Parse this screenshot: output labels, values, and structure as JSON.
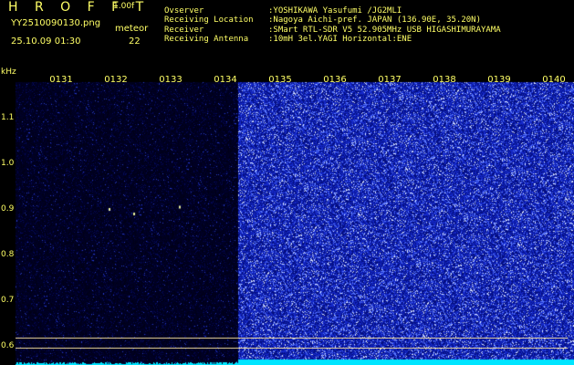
{
  "header": {
    "brand": "H R O F F T",
    "version": "1.00f",
    "filename": "YY2510090130.png",
    "meteor_label": "meteor",
    "datetime": "25.10.09 01:30",
    "meteor_count": "22",
    "info": [
      {
        "key": "Ovserver",
        "value": ":YOSHIKAWA Yasufumi /JG2MLI"
      },
      {
        "key": "Receiving Location",
        "value": ":Nagoya Aichi-pref. JAPAN (136.90E, 35.20N)"
      },
      {
        "key": "Receiver",
        "value": ":SMart RTL-SDR V5 52.905MHz USB HIGASHIMURAYAMA"
      },
      {
        "key": "Receiving Antenna",
        "value": ":10mH 3el.YAGI Horizontal:ENE"
      }
    ]
  },
  "axis": {
    "unit": "kHz",
    "time_ticks": [
      "0131",
      "0132",
      "0133",
      "0134",
      "0135",
      "0136",
      "0137",
      "0138",
      "0139",
      "0140"
    ],
    "freq_ticks": [
      "1.1",
      "1.0",
      "0.9",
      "0.8",
      "0.7",
      "0.6"
    ]
  },
  "colors": {
    "text": "#ffff66",
    "dark_bg": "#000010",
    "noise_bg": "#0a1ea8",
    "baseline": "#00e5ff"
  },
  "spectrogram": {
    "quiet_fraction": 0.415,
    "meteor_pings_freq_khz": [
      0.9,
      0.89,
      0.905
    ]
  }
}
